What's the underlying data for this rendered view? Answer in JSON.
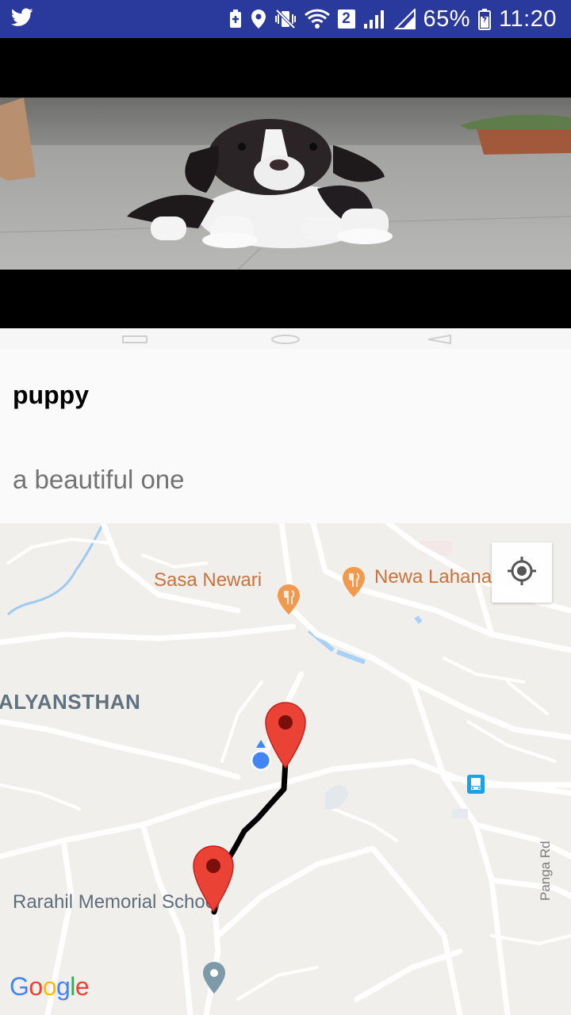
{
  "status_bar": {
    "left_icon": "twitter-icon",
    "icons": [
      "battery-saver-icon",
      "location-icon",
      "vibrate-mute-icon",
      "wifi-icon",
      "sim2-icon",
      "signal-icon",
      "signal-icon",
      "battery-icon"
    ],
    "sim_badge": "2",
    "battery_percent": "65%",
    "time": "11:20",
    "color": "#2a3a9c"
  },
  "media": {
    "image_icon": "puppy-photo"
  },
  "post": {
    "title": "puppy",
    "description": "a beautiful one"
  },
  "map": {
    "labels": {
      "restaurant_1": "Sasa Newari",
      "restaurant_2": "Newa Lahana",
      "area": "ALYANSTHAN",
      "school": "Rarahil Memorial School",
      "road": "Panga Rd"
    },
    "icons": {
      "locate": "my-location-icon",
      "restaurant": "restaurant-icon",
      "bus": "bus-stop-icon",
      "marker": "map-marker-icon",
      "user": "user-location-icon",
      "place": "place-icon"
    },
    "google_logo": [
      "G",
      "o",
      "o",
      "g",
      "l",
      "e"
    ],
    "route_color": "#000000",
    "marker_color": "#ea4335",
    "user_dot_color": "#4285f4"
  }
}
